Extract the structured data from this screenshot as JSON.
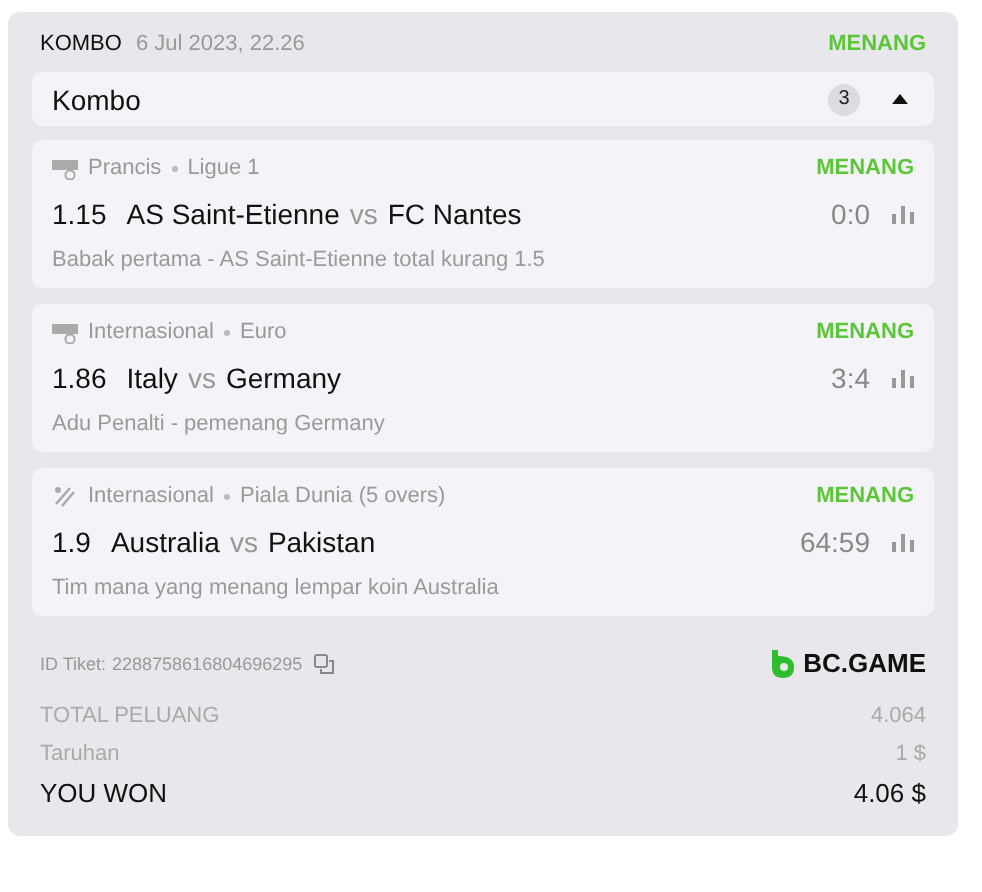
{
  "header": {
    "type": "KOMBO",
    "date": "6 Jul 2023, 22.26",
    "status": "MENANG"
  },
  "group": {
    "title": "Kombo",
    "count": "3",
    "expanded": true
  },
  "matches": [
    {
      "kind": "football",
      "country": "Prancis",
      "league": "Ligue 1",
      "status": "MENANG",
      "odds": "1.15",
      "home": "AS Saint-Etienne",
      "vs": "vs",
      "away": "FC Nantes",
      "score": "0:0",
      "market": "Babak pertama - AS Saint-Etienne total kurang 1.5"
    },
    {
      "kind": "football",
      "country": "Internasional",
      "league": "Euro",
      "status": "MENANG",
      "odds": "1.86",
      "home": "Italy",
      "vs": "vs",
      "away": "Germany",
      "score": "3:4",
      "market": "Adu Penalti - pemenang Germany"
    },
    {
      "kind": "cricket",
      "country": "Internasional",
      "league": "Piala Dunia (5 overs)",
      "status": "MENANG",
      "odds": "1.9",
      "home": "Australia",
      "vs": "vs",
      "away": "Pakistan",
      "score": "64:59",
      "market": "Tim mana yang menang lempar koin Australia"
    }
  ],
  "ticket": {
    "label": "ID Tiket:",
    "id": "2288758616804696295"
  },
  "brand": "BC.GAME",
  "summary": [
    {
      "kind": "muted",
      "label": "TOTAL PELUANG",
      "value": "4.064"
    },
    {
      "kind": "muted",
      "label": "Taruhan",
      "value": "1 $"
    },
    {
      "kind": "total",
      "label": "YOU WON",
      "value": "4.06 $"
    }
  ]
}
